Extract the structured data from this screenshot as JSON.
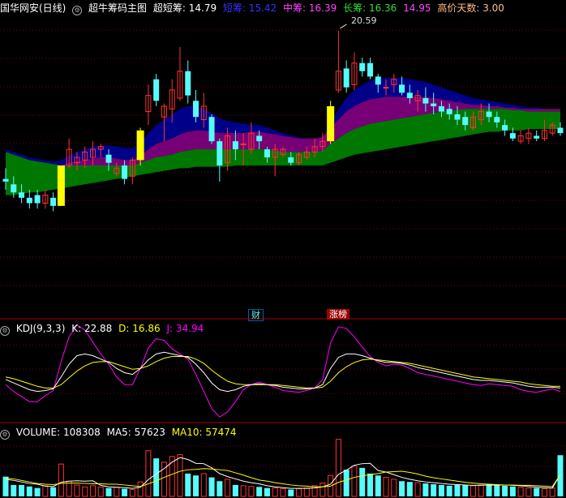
{
  "main_header": {
    "stock": "国华网安(日线)",
    "indicator": "超牛筹码主图",
    "items": [
      {
        "label": "超短筹:",
        "value": "14.79",
        "color": "#ffffff"
      },
      {
        "label": "短筹:",
        "value": "15.42",
        "color": "#3333ff"
      },
      {
        "label": "中筹:",
        "value": "16.39",
        "color": "#ff44ff"
      },
      {
        "label": "长筹:",
        "value": "16.36",
        "color": "#33dd33"
      },
      {
        "label": "",
        "value": "14.95",
        "color": "#ff44ff"
      },
      {
        "label": "高价天数:",
        "value": "3.00",
        "color": "#ffbb88"
      }
    ]
  },
  "peak_label": "20.59",
  "markers": {
    "cai": "财",
    "zhangting": "涨榜"
  },
  "kdj_header": {
    "name": "KDJ(9,3,3)",
    "k_label": "K:",
    "k_value": "22.88",
    "d_label": "D:",
    "d_value": "16.86",
    "j_label": "J:",
    "j_value": "34.94"
  },
  "vol_header": {
    "name": "VOLUME:",
    "value": "108308",
    "ma5_label": "MA5:",
    "ma5_value": "57623",
    "ma10_label": "MA10:",
    "ma10_value": "57474"
  },
  "colors": {
    "up": "#ff3232",
    "down": "#54fcfc",
    "limit": "#ffff00",
    "grid": "#800000",
    "band_long": "#007700",
    "band_mid": "#770077",
    "band_short": "#000088",
    "k_line": "#ffffff",
    "d_line": "#ffff00",
    "j_line": "#ff00ff"
  },
  "chart_data": {
    "type": "candlestick",
    "candles": [
      [
        15.1,
        15.0,
        15.5,
        14.7
      ],
      [
        14.9,
        14.6,
        15.2,
        14.4
      ],
      [
        14.6,
        14.4,
        14.9,
        14.2
      ],
      [
        14.4,
        14.2,
        14.7,
        14.0
      ],
      [
        14.5,
        14.2,
        14.7,
        14.0
      ],
      [
        14.2,
        14.5,
        14.7,
        14.0
      ],
      [
        14.4,
        14.1,
        14.6,
        13.9
      ],
      [
        14.1,
        15.6,
        15.6,
        14.1
      ],
      [
        15.6,
        16.2,
        16.6,
        15.5
      ],
      [
        15.7,
        15.9,
        16.1,
        15.4
      ],
      [
        15.8,
        16.1,
        16.3,
        15.5
      ],
      [
        15.9,
        16.2,
        16.5,
        15.6
      ],
      [
        16.2,
        16.3,
        16.4,
        15.9
      ],
      [
        16.0,
        15.7,
        16.2,
        15.4
      ],
      [
        15.3,
        15.5,
        15.7,
        15.2
      ],
      [
        15.6,
        15.1,
        15.8,
        14.9
      ],
      [
        15.2,
        15.8,
        15.9,
        14.9
      ],
      [
        15.8,
        16.9,
        17.0,
        15.6
      ],
      [
        17.6,
        18.2,
        18.6,
        17.1
      ],
      [
        18.8,
        18.0,
        19.0,
        17.8
      ],
      [
        17.4,
        17.8,
        17.9,
        16.5
      ],
      [
        17.7,
        18.4,
        18.8,
        17.2
      ],
      [
        18.1,
        19.1,
        20.0,
        18.0
      ],
      [
        19.1,
        18.2,
        19.5,
        17.9
      ],
      [
        18.0,
        17.4,
        18.4,
        17.2
      ],
      [
        17.3,
        17.8,
        18.3,
        17.0
      ],
      [
        17.4,
        16.5,
        17.5,
        16.4
      ],
      [
        16.5,
        15.6,
        16.6,
        15.0
      ],
      [
        15.7,
        16.7,
        17.0,
        15.4
      ],
      [
        16.5,
        16.2,
        16.9,
        15.8
      ],
      [
        16.4,
        16.4,
        16.8,
        15.6
      ],
      [
        16.2,
        16.8,
        17.2,
        16.0
      ],
      [
        16.7,
        16.5,
        16.9,
        16.2
      ],
      [
        16.2,
        15.9,
        16.3,
        15.7
      ],
      [
        15.9,
        16.2,
        16.4,
        15.2
      ],
      [
        16.0,
        16.2,
        16.3,
        15.9
      ],
      [
        15.9,
        15.7,
        16.1,
        15.6
      ],
      [
        15.7,
        16.0,
        16.1,
        15.6
      ],
      [
        15.9,
        16.1,
        16.3,
        15.8
      ],
      [
        16.1,
        16.3,
        16.6,
        15.9
      ],
      [
        16.3,
        16.5,
        16.8,
        16.1
      ],
      [
        16.5,
        17.8,
        18.0,
        16.4
      ],
      [
        18.4,
        19.1,
        20.6,
        18.3
      ],
      [
        19.2,
        18.5,
        19.5,
        18.3
      ],
      [
        18.6,
        19.4,
        19.8,
        18.4
      ],
      [
        19.4,
        19.1,
        19.6,
        18.9
      ],
      [
        19.4,
        18.9,
        19.6,
        18.8
      ],
      [
        18.9,
        18.6,
        19.0,
        18.3
      ],
      [
        18.5,
        18.5,
        18.8,
        18.2
      ],
      [
        18.6,
        18.8,
        19.0,
        18.3
      ],
      [
        18.6,
        18.3,
        18.9,
        18.2
      ],
      [
        18.3,
        18.1,
        18.6,
        17.9
      ],
      [
        18.0,
        18.2,
        18.4,
        17.6
      ],
      [
        18.1,
        17.9,
        18.5,
        17.6
      ],
      [
        17.9,
        17.8,
        18.3,
        17.5
      ],
      [
        17.8,
        17.6,
        18.0,
        17.4
      ],
      [
        17.7,
        17.5,
        17.9,
        17.3
      ],
      [
        17.5,
        17.3,
        17.8,
        17.1
      ],
      [
        17.4,
        17.1,
        17.6,
        16.9
      ],
      [
        17.0,
        17.4,
        17.6,
        16.9
      ],
      [
        17.3,
        17.6,
        17.9,
        17.1
      ],
      [
        17.6,
        17.4,
        17.9,
        17.2
      ],
      [
        17.4,
        17.2,
        17.6,
        17.0
      ],
      [
        17.1,
        16.9,
        17.3,
        16.7
      ],
      [
        16.8,
        16.6,
        17.0,
        16.5
      ],
      [
        16.5,
        16.7,
        16.9,
        16.4
      ],
      [
        16.6,
        16.8,
        17.0,
        16.4
      ],
      [
        16.7,
        16.6,
        16.9,
        16.5
      ],
      [
        16.6,
        16.9,
        17.3,
        16.5
      ],
      [
        16.8,
        17.1,
        17.2,
        16.7
      ],
      [
        17.0,
        16.8,
        17.2,
        16.7
      ]
    ],
    "limit_up_indices": [
      7,
      17,
      41
    ],
    "peak_index": 42,
    "price_range": [
      10.0,
      21.2
    ],
    "bands": {
      "long_upper": [
        16.1,
        16.0,
        15.9,
        15.8,
        15.75,
        15.7,
        15.65,
        15.6,
        15.6,
        15.6,
        15.6,
        15.6,
        15.6,
        15.6,
        15.6,
        15.6,
        15.6,
        15.7,
        15.8,
        15.9,
        15.95,
        16.0,
        16.1,
        16.15,
        16.2,
        16.2,
        16.2,
        16.2,
        16.2,
        16.2,
        16.2,
        16.2,
        16.2,
        16.2,
        16.15,
        16.1,
        16.1,
        16.1,
        16.1,
        16.1,
        16.15,
        16.4,
        16.6,
        16.8,
        16.95,
        17.05,
        17.15,
        17.2,
        17.25,
        17.3,
        17.35,
        17.4,
        17.45,
        17.5,
        17.55,
        17.6,
        17.65,
        17.65,
        17.7,
        17.7,
        17.7,
        17.7,
        17.7,
        17.7,
        17.65,
        17.65,
        17.6,
        17.6,
        17.6,
        17.6,
        17.6
      ],
      "long_lower": [
        14.5,
        14.5,
        14.55,
        14.6,
        14.6,
        14.65,
        14.7,
        14.75,
        14.8,
        14.85,
        14.9,
        14.95,
        15.0,
        15.05,
        15.1,
        15.15,
        15.2,
        15.25,
        15.3,
        15.35,
        15.4,
        15.45,
        15.5,
        15.5,
        15.55,
        15.55,
        15.55,
        15.55,
        15.55,
        15.6,
        15.6,
        15.6,
        15.6,
        15.6,
        15.6,
        15.6,
        15.6,
        15.6,
        15.6,
        15.6,
        15.6,
        15.7,
        15.8,
        15.9,
        16.0,
        16.05,
        16.1,
        16.15,
        16.2,
        16.25,
        16.3,
        16.35,
        16.4,
        16.45,
        16.5,
        16.55,
        16.6,
        16.65,
        16.7,
        16.75,
        16.8,
        16.85,
        16.85,
        16.9,
        16.9,
        16.9,
        16.95,
        16.95,
        16.95,
        16.95,
        16.95
      ],
      "mid_upper": [
        16.1,
        16.0,
        15.9,
        15.8,
        15.75,
        15.7,
        15.65,
        15.6,
        15.7,
        15.75,
        15.8,
        15.85,
        15.9,
        15.9,
        15.85,
        15.8,
        15.8,
        15.95,
        16.2,
        16.4,
        16.5,
        16.6,
        16.75,
        16.85,
        16.9,
        16.9,
        16.85,
        16.8,
        16.8,
        16.8,
        16.8,
        16.85,
        16.85,
        16.8,
        16.75,
        16.7,
        16.65,
        16.6,
        16.6,
        16.6,
        16.65,
        17.0,
        17.3,
        17.6,
        17.8,
        17.95,
        18.05,
        18.1,
        18.15,
        18.15,
        18.15,
        18.15,
        18.15,
        18.15,
        18.1,
        18.05,
        18.0,
        17.95,
        17.9,
        17.85,
        17.85,
        17.8,
        17.8,
        17.75,
        17.75,
        17.7,
        17.7,
        17.7,
        17.7,
        17.7,
        17.7
      ],
      "short_upper": [
        16.2,
        16.1,
        16.0,
        15.9,
        15.85,
        15.8,
        15.75,
        15.8,
        15.95,
        16.1,
        16.2,
        16.3,
        16.35,
        16.35,
        16.3,
        16.25,
        16.25,
        16.45,
        16.8,
        17.1,
        17.3,
        17.5,
        17.7,
        17.8,
        17.8,
        17.7,
        17.55,
        17.35,
        17.25,
        17.2,
        17.15,
        17.1,
        17.1,
        17.0,
        16.9,
        16.8,
        16.7,
        16.65,
        16.6,
        16.6,
        16.65,
        17.2,
        17.7,
        18.1,
        18.4,
        18.6,
        18.75,
        18.8,
        18.85,
        18.85,
        18.85,
        18.8,
        18.75,
        18.7,
        18.6,
        18.5,
        18.4,
        18.3,
        18.2,
        18.1,
        18.05,
        18.0,
        17.95,
        17.9,
        17.85,
        17.8,
        17.75,
        17.75,
        17.7,
        17.7,
        17.7
      ]
    },
    "kdj": {
      "range": [
        0,
        100
      ],
      "k": [
        42,
        38,
        34,
        30,
        28,
        29,
        31,
        45,
        60,
        70,
        72,
        70,
        66,
        62,
        55,
        50,
        48,
        55,
        65,
        72,
        74,
        72,
        70,
        68,
        60,
        50,
        38,
        30,
        28,
        30,
        34,
        36,
        37,
        36,
        35,
        33,
        32,
        31,
        31,
        32,
        36,
        55,
        68,
        72,
        72,
        70,
        67,
        64,
        62,
        62,
        61,
        59,
        56,
        54,
        52,
        50,
        48,
        46,
        44,
        42,
        41,
        41,
        40,
        39,
        38,
        36,
        34,
        33,
        33,
        33,
        32
      ],
      "d": [
        45,
        43,
        40,
        37,
        34,
        32,
        32,
        36,
        44,
        52,
        58,
        62,
        63,
        63,
        60,
        57,
        54,
        55,
        58,
        63,
        67,
        69,
        69,
        69,
        66,
        61,
        53,
        46,
        40,
        37,
        36,
        36,
        36,
        36,
        36,
        35,
        34,
        33,
        32,
        32,
        33,
        40,
        50,
        57,
        62,
        65,
        66,
        65,
        64,
        63,
        62,
        61,
        59,
        57,
        55,
        53,
        51,
        49,
        47,
        45,
        44,
        43,
        42,
        41,
        40,
        39,
        37,
        36,
        35,
        34,
        34
      ],
      "j": [
        36,
        28,
        22,
        16,
        16,
        23,
        29,
        63,
        92,
        106,
        100,
        86,
        72,
        60,
        45,
        36,
        36,
        55,
        79,
        90,
        88,
        78,
        72,
        66,
        48,
        28,
        8,
        -2,
        4,
        16,
        30,
        36,
        39,
        36,
        33,
        29,
        28,
        27,
        29,
        32,
        42,
        85,
        104,
        102,
        92,
        80,
        69,
        62,
        58,
        60,
        59,
        55,
        50,
        48,
        46,
        44,
        42,
        40,
        38,
        36,
        35,
        37,
        36,
        35,
        34,
        30,
        28,
        27,
        29,
        31,
        28
      ],
      "kdj_range_note": ""
    },
    "volume": {
      "range": [
        0,
        160000
      ],
      "values": [
        52000,
        30000,
        30000,
        26000,
        22000,
        28000,
        24000,
        85000,
        40000,
        30000,
        25000,
        28000,
        24000,
        22000,
        24000,
        20000,
        18000,
        38000,
        120000,
        100000,
        90000,
        105000,
        110000,
        60000,
        55000,
        60000,
        50000,
        40000,
        45000,
        30000,
        28000,
        26000,
        25000,
        22000,
        22000,
        20000,
        18000,
        20000,
        22000,
        28000,
        35000,
        55000,
        150000,
        70000,
        80000,
        75000,
        60000,
        55000,
        50000,
        45000,
        40000,
        38000,
        36000,
        34000,
        32000,
        30000,
        28000,
        30000,
        30000,
        28000,
        30000,
        32000,
        30000,
        28000,
        26000,
        24000,
        22000,
        22000,
        20000,
        22000,
        108308
      ],
      "ma5": [
        45000,
        42000,
        38000,
        34000,
        32000,
        27000,
        26000,
        37000,
        40000,
        41000,
        40000,
        41000,
        29000,
        25000,
        24000,
        23000,
        21000,
        24000,
        44000,
        59000,
        73000,
        90000,
        102000,
        97000,
        87000,
        86000,
        75000,
        60000,
        52000,
        46000,
        40000,
        36000,
        33000,
        28000,
        25000,
        23000,
        21000,
        21000,
        21000,
        22000,
        25000,
        32000,
        58000,
        69000,
        82000,
        86000,
        87000,
        68000,
        64000,
        57000,
        50000,
        45000,
        41000,
        38000,
        36000,
        34000,
        32000,
        31000,
        30000,
        29000,
        29000,
        30000,
        30000,
        30000,
        29000,
        28000,
        26000,
        24000,
        23000,
        22000,
        57623
      ],
      "ma10": [
        48000,
        46000,
        42000,
        38000,
        34000,
        32000,
        31000,
        34000,
        35000,
        35000,
        34000,
        33000,
        33000,
        32000,
        32000,
        30000,
        28000,
        26000,
        33000,
        41000,
        50000,
        58000,
        66000,
        70000,
        71000,
        73000,
        72000,
        70000,
        68000,
        62000,
        56000,
        49000,
        43000,
        40000,
        36000,
        33000,
        30000,
        28000,
        27000,
        25000,
        25000,
        27000,
        37000,
        43000,
        50000,
        54000,
        57000,
        60000,
        64000,
        65000,
        66000,
        63000,
        59000,
        53000,
        49000,
        46000,
        43000,
        40000,
        37000,
        35000,
        33000,
        32000,
        31000,
        30000,
        30000,
        29000,
        29000,
        28000,
        27000,
        26000,
        57474
      ]
    }
  }
}
